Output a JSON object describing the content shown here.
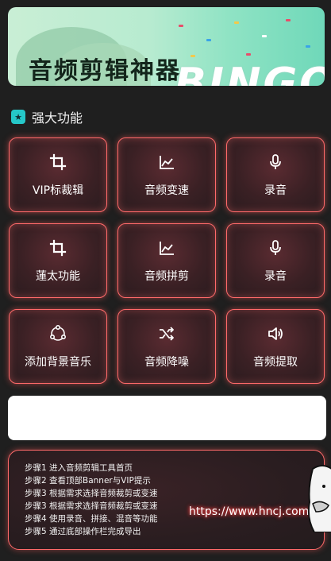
{
  "banner": {
    "title": "音频剪辑神器",
    "deco_text": "BINGO!"
  },
  "section": {
    "title": "强大功能"
  },
  "features": [
    {
      "label": "VIP标裁辑",
      "icon": "crop-icon"
    },
    {
      "label": "音频变速",
      "icon": "line-chart-icon"
    },
    {
      "label": "录音",
      "icon": "microphone-icon"
    },
    {
      "label": "蓮太功能",
      "icon": "crop-icon"
    },
    {
      "label": "音频拼剪",
      "icon": "line-chart-icon"
    },
    {
      "label": "录音",
      "icon": "microphone-icon"
    },
    {
      "label": "添加背景音乐",
      "icon": "share-nodes-icon"
    },
    {
      "label": "音频降噪",
      "icon": "shuffle-icon"
    },
    {
      "label": "音频提取",
      "icon": "volume-icon"
    }
  ],
  "input": {
    "value": ""
  },
  "steps": [
    "步骤1 进入音频剪辑工具首页",
    "步骤2 查看顶部Banner与VIP提示",
    "步骤3 根据需求选择音频裁剪或变速",
    "步骤3 根据需求选择音频裁剪或变速",
    "步骤4 使用录音、拼接、混音等功能",
    "步骤5 通过底部操作栏完成导出"
  ],
  "watermark": {
    "url": "https://www.hncj.com/"
  },
  "colors": {
    "background": "#1f1f1f",
    "card_border": "#ff6a6a",
    "accent": "#25c7c8"
  }
}
